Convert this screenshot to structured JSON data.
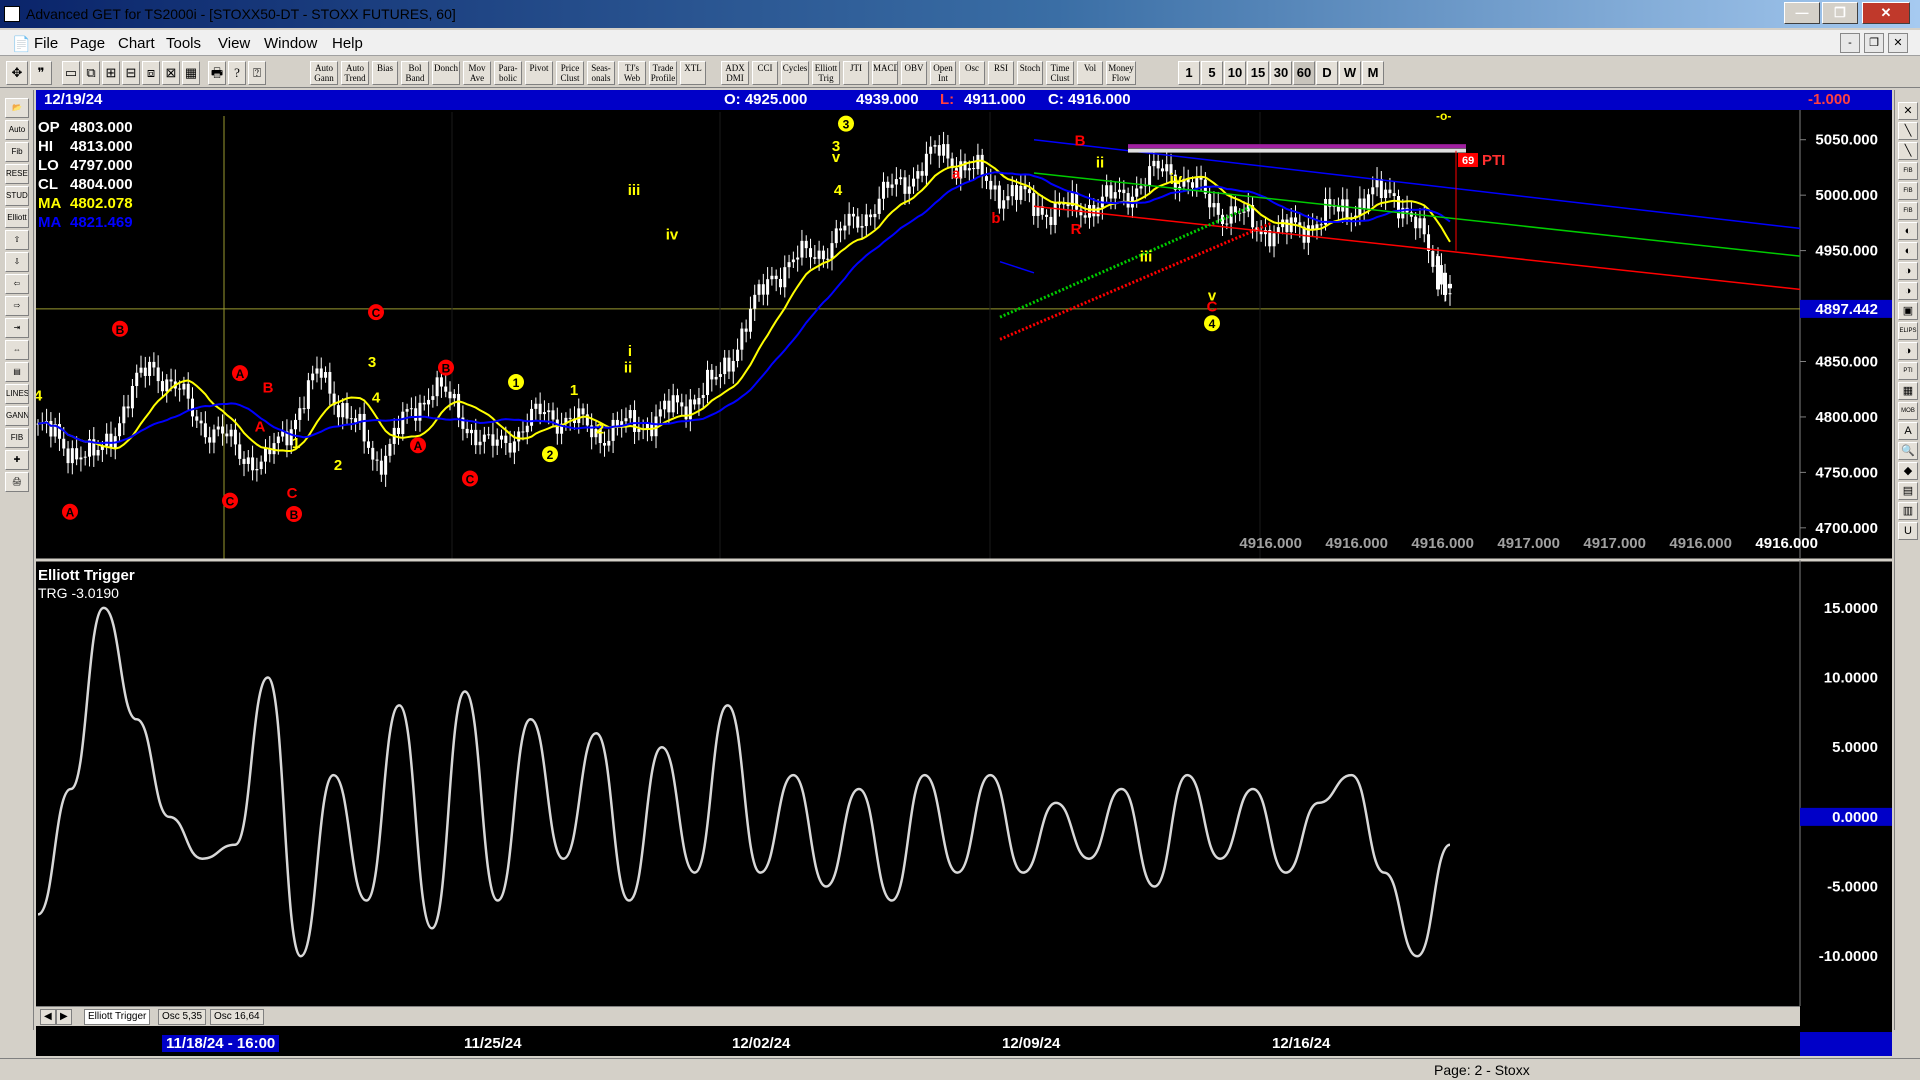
{
  "window": {
    "title": "Advanced GET for TS2000i - [STOXX50-DT - STOXX FUTURES, 60]",
    "min_label": "—",
    "max_label": "❐",
    "close_label": "✕"
  },
  "menu": [
    "File",
    "Page",
    "Chart",
    "Tools",
    "View",
    "Window",
    "Help"
  ],
  "mdi_controls": [
    "-",
    "❐",
    "✕"
  ],
  "toolbar": {
    "studies": [
      {
        "label": "Auto Gann"
      },
      {
        "label": "Auto Trend"
      },
      {
        "label": "Bias"
      },
      {
        "label": "Bol Band"
      },
      {
        "label": "Donch"
      },
      {
        "label": "Mov Ave"
      },
      {
        "label": "Para- bolic"
      },
      {
        "label": "Pivot"
      },
      {
        "label": "Price Clust"
      },
      {
        "label": "Seas- onals"
      },
      {
        "label": "TJ's Web"
      },
      {
        "label": "Trade Profile"
      },
      {
        "label": "XTL"
      },
      {
        "label": "ADX DMI"
      },
      {
        "label": "CCI"
      },
      {
        "label": "Cycles"
      },
      {
        "label": "Elliott Trig"
      },
      {
        "label": "JTI"
      },
      {
        "label": "MACD"
      },
      {
        "label": "OBV"
      },
      {
        "label": "Open Int"
      },
      {
        "label": "Osc"
      },
      {
        "label": "RSI"
      },
      {
        "label": "Stoch"
      },
      {
        "label": "Time Clust"
      },
      {
        "label": "Vol"
      },
      {
        "label": "Money Flow"
      }
    ],
    "timeframes": [
      "1",
      "5",
      "10",
      "15",
      "30",
      "60",
      "D",
      "W",
      "M"
    ],
    "active_timeframe": "60"
  },
  "left_tools": [
    "📂",
    "Auto",
    "Fib",
    "RESET",
    "STUDY",
    "Elliott",
    "⇧",
    "⇩",
    "⇦",
    "⇨",
    "⇥",
    "⇔",
    "▤",
    "LINES",
    "GANN",
    "FIB",
    "✚",
    "🖨"
  ],
  "right_tools": [
    "✕",
    "╲",
    "╲",
    "FIB RET",
    "FIB EXT",
    "FIB TIME",
    "◐",
    "◐",
    "◑",
    "◑",
    "▣",
    "ELIPS",
    "◑",
    "PTI",
    "▦",
    "MOB",
    "A",
    "🔍",
    "◆",
    "▤",
    "▥",
    "U"
  ],
  "info_bar": {
    "date": "12/19/24",
    "open": "O: 4925.000",
    "high": "4939.000",
    "low_label": "L:",
    "low": "4911.000",
    "close": "C: 4916.000",
    "change": "-1.000"
  },
  "price_panel": {
    "readout": [
      {
        "label": "OP",
        "value": "4803.000",
        "color": "#ffffff"
      },
      {
        "label": "HI",
        "value": "4813.000",
        "color": "#ffffff"
      },
      {
        "label": "LO",
        "value": "4797.000",
        "color": "#ffffff"
      },
      {
        "label": "CL",
        "value": "4804.000",
        "color": "#ffffff"
      },
      {
        "label": "MA",
        "value": "4802.078",
        "color": "#ffff00"
      },
      {
        "label": "MA",
        "value": "4821.469",
        "color": "#0000ff"
      }
    ],
    "y_ticks": [
      "5050.000",
      "5000.000",
      "4950.000",
      "4900.000",
      "4850.000",
      "4800.000",
      "4750.000",
      "4700.000"
    ],
    "cursor_price": "4897.442",
    "projections": [
      "4916.000",
      "4916.000",
      "4916.000",
      "4917.000",
      "4917.000",
      "4916.000",
      "4916.000"
    ],
    "pti_value": "69",
    "pti_label": "PTI",
    "top_marker": "-o-"
  },
  "chart_data": {
    "type": "candlestick",
    "title": "STOXX50-DT - STOXX FUTURES, 60",
    "interval": "60 minute",
    "ylim": [
      4680,
      5075
    ],
    "x_dates": [
      "11/18/24 - 16:00",
      "11/25/24",
      "12/02/24",
      "12/09/24",
      "12/16/24"
    ],
    "close_path": [
      {
        "date": "11/18/24",
        "close": 4790
      },
      {
        "date": "11/18/24",
        "close": 4760
      },
      {
        "date": "11/19/24",
        "close": 4850
      },
      {
        "date": "11/20/24",
        "close": 4790
      },
      {
        "date": "11/21/24",
        "close": 4755
      },
      {
        "date": "11/22/24",
        "close": 4840
      },
      {
        "date": "11/22/24",
        "close": 4760
      },
      {
        "date": "11/25/24",
        "close": 4830
      },
      {
        "date": "11/26/24",
        "close": 4770
      },
      {
        "date": "11/27/24",
        "close": 4805
      },
      {
        "date": "11/28/24",
        "close": 4785
      },
      {
        "date": "11/29/24",
        "close": 4800
      },
      {
        "date": "12/02/24",
        "close": 4830
      },
      {
        "date": "12/03/24",
        "close": 4930
      },
      {
        "date": "12/04/24",
        "close": 4955
      },
      {
        "date": "12/05/24",
        "close": 5000
      },
      {
        "date": "12/06/24",
        "close": 5040
      },
      {
        "date": "12/09/24",
        "close": 5005
      },
      {
        "date": "12/10/24",
        "close": 4985
      },
      {
        "date": "12/11/24",
        "close": 4995
      },
      {
        "date": "12/12/24",
        "close": 5025
      },
      {
        "date": "12/13/24",
        "close": 4985
      },
      {
        "date": "12/16/24",
        "close": 4965
      },
      {
        "date": "12/17/24",
        "close": 4985
      },
      {
        "date": "12/18/24",
        "close": 5005
      },
      {
        "date": "12/19/24",
        "close": 4916
      }
    ],
    "series": [
      {
        "name": "MA",
        "color": "#ffff00"
      },
      {
        "name": "MA",
        "color": "#0000ff"
      }
    ],
    "channel_lines": [
      {
        "color": "#0000ff",
        "from": 5050,
        "to": 4970
      },
      {
        "color": "#00cc00",
        "from": 5020,
        "to": 4945
      },
      {
        "color": "#ff0000",
        "from": 4990,
        "to": 4915
      }
    ],
    "horizontal_line": 4897.442,
    "wave_labels": [
      {
        "text": "A",
        "color": "#ff0000",
        "circle": true,
        "at": 4710
      },
      {
        "text": "4",
        "color": "#ffff00",
        "at": 4815
      },
      {
        "text": "B",
        "color": "#ff0000",
        "circle": true,
        "at": 4875
      },
      {
        "text": "C",
        "color": "#ff0000",
        "circle": true,
        "at": 4720
      },
      {
        "text": "A",
        "color": "#ff0000",
        "circle": true,
        "at": 4835
      },
      {
        "text": "B",
        "color": "#ff0000",
        "at": 4822
      },
      {
        "text": "A",
        "color": "#ff0000",
        "at": 4787
      },
      {
        "text": "1",
        "color": "#ffff00",
        "at": 4772
      },
      {
        "text": "C",
        "color": "#ff0000",
        "at": 4727
      },
      {
        "text": "B",
        "color": "#ff0000",
        "circle": true,
        "at": 4708
      },
      {
        "text": "2",
        "color": "#ffff00",
        "at": 4752
      },
      {
        "text": "3",
        "color": "#ffff00",
        "at": 4845
      },
      {
        "text": "4",
        "color": "#ffff00",
        "at": 4813
      },
      {
        "text": "C",
        "color": "#ff0000",
        "circle": true,
        "at": 4890
      },
      {
        "text": "A",
        "color": "#ff0000",
        "circle": true,
        "at": 4770
      },
      {
        "text": "B",
        "color": "#ff0000",
        "circle": true,
        "at": 4840
      },
      {
        "text": "C",
        "color": "#ff0000",
        "circle": true,
        "at": 4740
      },
      {
        "text": "1",
        "color": "#ffff00",
        "circle": true,
        "at": 4827
      },
      {
        "text": "2",
        "color": "#ffff00",
        "circle": true,
        "at": 4762
      },
      {
        "text": "1",
        "color": "#ffff00",
        "at": 4820
      },
      {
        "text": "2",
        "color": "#ffff00",
        "at": 4785
      },
      {
        "text": "i",
        "color": "#ffff00",
        "at": 4855
      },
      {
        "text": "ii",
        "color": "#ffff00",
        "at": 4840
      },
      {
        "text": "iii",
        "color": "#ffff00",
        "at": 5000
      },
      {
        "text": "iv",
        "color": "#ffff00",
        "at": 4960
      },
      {
        "text": "3",
        "color": "#ffff00",
        "at": 5040
      },
      {
        "text": "v",
        "color": "#ffff00",
        "at": 5030
      },
      {
        "text": "4",
        "color": "#ffff00",
        "at": 5000
      },
      {
        "text": "3",
        "color": "#ffff00",
        "circle": true,
        "at": 5060
      },
      {
        "text": "a",
        "color": "#ff0000",
        "at": 5015
      },
      {
        "text": "b",
        "color": "#ff0000",
        "at": 4975
      },
      {
        "text": "R",
        "color": "#ff0000",
        "at": 4965
      },
      {
        "text": "B",
        "color": "#ff0000",
        "at": 5045
      },
      {
        "text": "ii",
        "color": "#ffff00",
        "at": 5025
      },
      {
        "text": "iii",
        "color": "#ffff00",
        "at": 4940
      },
      {
        "text": "iv",
        "color": "#ffff00",
        "at": 5010
      },
      {
        "text": "v",
        "color": "#ffff00",
        "at": 4905
      },
      {
        "text": "C",
        "color": "#ff0000",
        "at": 4895
      },
      {
        "text": "4",
        "color": "#ffff00",
        "circle": true,
        "at": 4880
      }
    ]
  },
  "oscillator": {
    "title": "Elliott Trigger",
    "readout": "TRG -3.0190",
    "y_ticks": [
      "15.0000",
      "10.0000",
      "5.0000",
      "0.0000",
      "-5.0000",
      "-10.0000"
    ],
    "zero_label": "0.0000",
    "ylim": [
      -13,
      17
    ],
    "values": [
      -7,
      2,
      15,
      7,
      0,
      -3,
      -2,
      10,
      -10,
      3,
      -6,
      8,
      -8,
      9,
      -6,
      7,
      -3,
      6,
      -6,
      5,
      -4,
      8,
      -4,
      3,
      -5,
      2,
      -6,
      3,
      -4,
      3,
      -4,
      1,
      -3,
      2,
      -5,
      3,
      -3,
      2,
      -4,
      1,
      3,
      -4,
      -10,
      -2
    ]
  },
  "tabs": [
    "Elliott Trigger",
    "Osc 5,35",
    "Osc 16,64"
  ],
  "tab_nav": [
    "◀",
    "▶"
  ],
  "status": {
    "page": "Page: 2 - Stoxx"
  }
}
